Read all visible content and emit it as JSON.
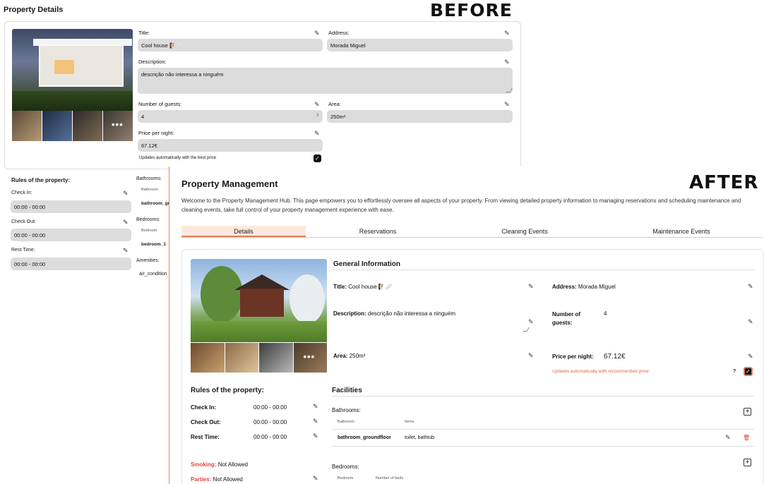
{
  "banners": {
    "before": "BEFORE",
    "after": "AFTER"
  },
  "before": {
    "page_title": "Property Details",
    "title_label": "Title:",
    "title_value": "Cool house 🧗🩹",
    "address_label": "Address:",
    "address_value": "Morada Miguel",
    "description_label": "Description:",
    "description_value": "descrição não interessa a ninguém",
    "guests_label": "Number of guests:",
    "guests_value": "4",
    "area_label": "Area:",
    "area_value": "250m²",
    "price_label": "Price per night:",
    "price_value": "67.12€",
    "auto_update_label": "Updates automatically with the best price",
    "rules_title": "Rules of the property:",
    "check_in_label": "Check In:",
    "check_in_value": "00:00 - 00:00",
    "check_out_label": "Check Out:",
    "check_out_value": "00:00 - 00:00",
    "rest_time_label": "Rest Time:",
    "rest_time_value": "00:00 - 00:00",
    "bathrooms_label": "Bathrooms:",
    "bathroom_col": "Bathroom",
    "bathroom_value": "bathroom_gr",
    "bedrooms_label": "Bedrooms:",
    "bedroom_col": "Bedroom",
    "bedroom_value": "bedroom_1",
    "amenities_label": "Amenities:",
    "amenity_value": "air_condition"
  },
  "after": {
    "page_title": "Property Management",
    "description": "Welcome to the Property Management Hub. This page empowers you to effortlessly oversee all aspects of your property. From viewing detailed property information to managing reservations and scheduling maintenance and cleaning events, take full control of your property management experience with ease.",
    "tabs": [
      "Details",
      "Reservations",
      "Cleaning Events",
      "Maintenance Events"
    ],
    "general_info_title": "General Information",
    "title_label": "Title:",
    "title_value": "Cool house 🧗🩹",
    "address_label": "Address:",
    "address_value": "Morada Miguel",
    "description_label": "Description:",
    "description_value": "descrição não interessa a ninguém",
    "guests_label": "Number of guests:",
    "guests_value": "4",
    "area_label": "Area:",
    "area_value": "250m²",
    "price_label": "Price per night:",
    "price_value": "67.12€",
    "auto_update_label": "Updates automatically with recommended price:",
    "help_mark": "?",
    "rules_title": "Rules of the property:",
    "check_in_label": "Check In:",
    "check_in_value": "00:00 - 00:00",
    "check_out_label": "Check Out:",
    "check_out_value": "00:00 - 00:00",
    "rest_time_label": "Rest Time:",
    "rest_time_value": "00:00 - 00:00",
    "smoking_label": "Smoking:",
    "smoking_value": "Not Allowed",
    "parties_label": "Parties:",
    "parties_value": "Not Allowed",
    "facilities_title": "Facilities",
    "bathrooms_label": "Bathrooms:",
    "bathroom_col": "Bathroom",
    "items_col": "Items",
    "bathroom_name": "bathroom_groundfloor",
    "bathroom_items": "toilet, bathtub",
    "bedrooms_label": "Bedrooms:",
    "bedroom_col": "Bedroom",
    "beds_col": "Number of beds"
  },
  "icons": {
    "more": "•••",
    "edit": "edit-icon",
    "add": "plus-icon",
    "delete": "trash-icon"
  },
  "colors": {
    "accent": "#e87c55",
    "danger": "#e0443a",
    "field_bg": "#dcdcdc",
    "tab_active_bg": "#fde8df"
  }
}
